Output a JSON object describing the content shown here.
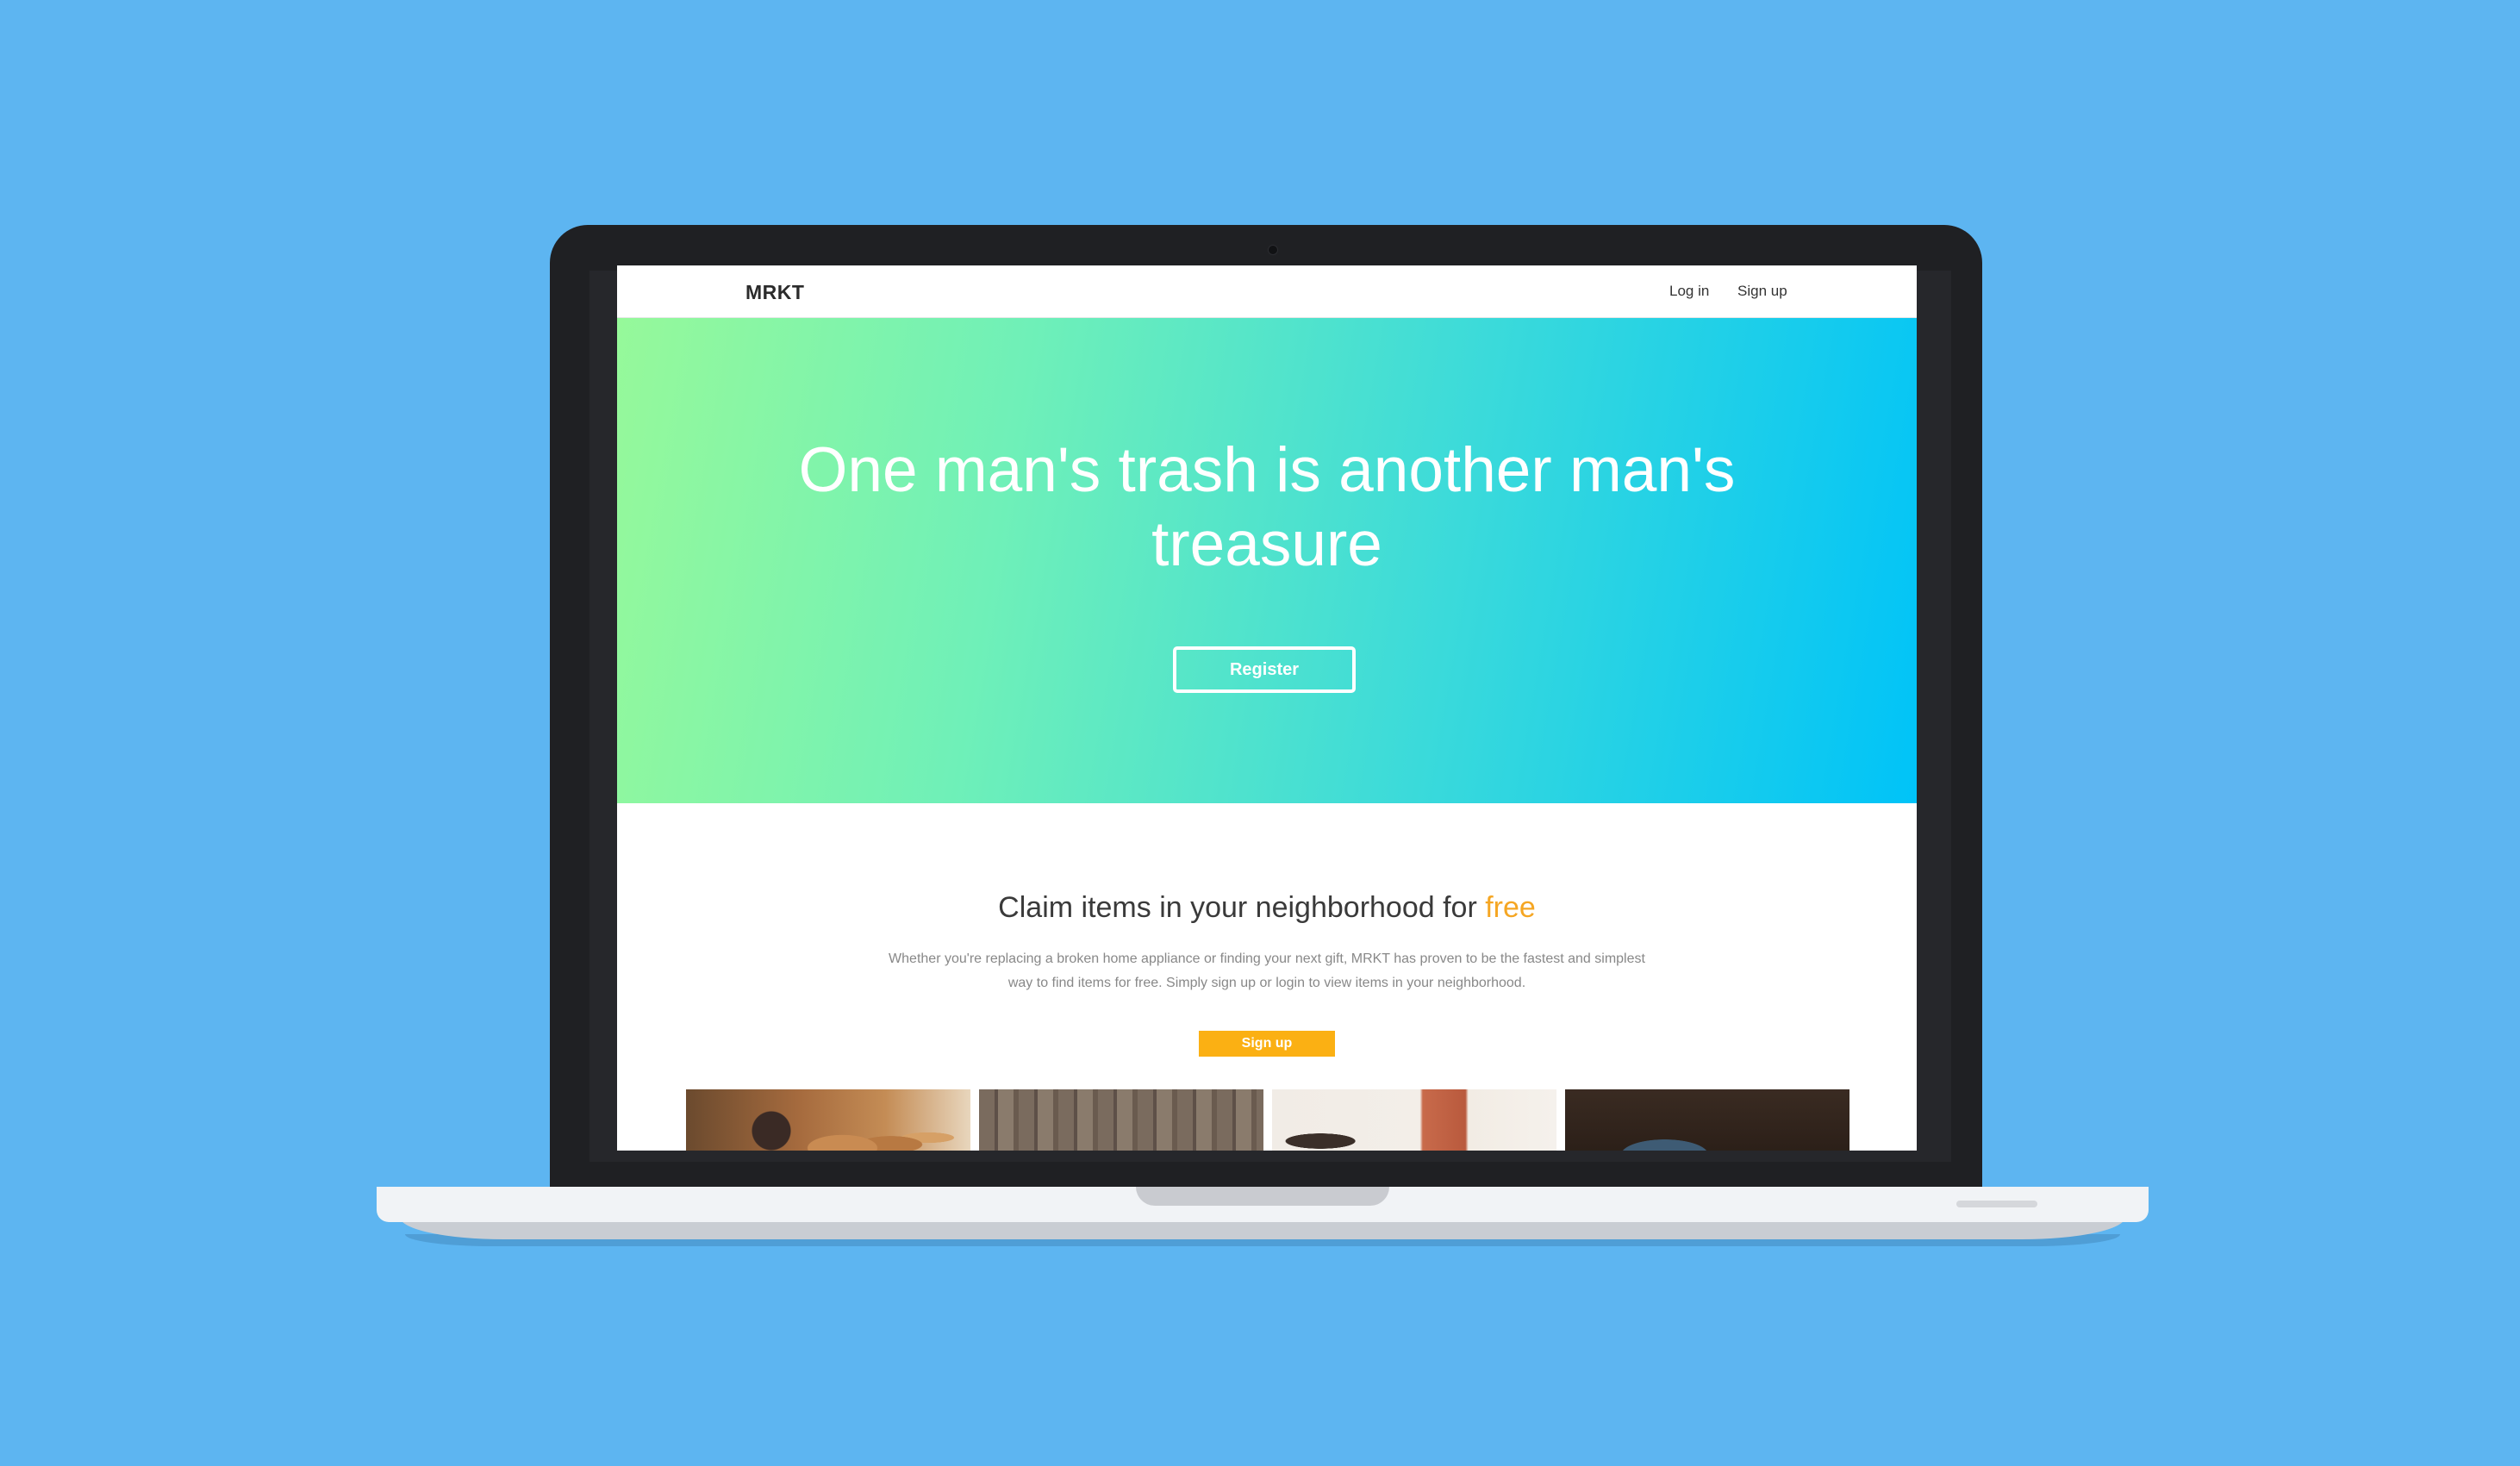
{
  "nav": {
    "brand": "MRKT",
    "login_label": "Log in",
    "signup_label": "Sign up"
  },
  "hero": {
    "title": "One man's trash is another man's treasure",
    "register_label": "Register"
  },
  "info": {
    "title_prefix": "Claim items in your neighborhood for ",
    "title_highlight": "free",
    "body": "Whether you're replacing a broken home appliance or finding your next gift, MRKT has proven to be the fastest and simplest way to find items for free. Simply sign up or login to view items in your neighborhood.",
    "signup_label": "Sign up"
  },
  "colors": {
    "background": "#5db5f1",
    "hero_gradient_start": "#96f99a",
    "hero_gradient_end": "#00c3f8",
    "accent": "#f5a623",
    "signup_button": "#fbb013"
  },
  "gallery": [
    {
      "subject": "wooden-spoons"
    },
    {
      "subject": "wood-planks"
    },
    {
      "subject": "leather-chair"
    },
    {
      "subject": "dark-wood-denim"
    }
  ]
}
